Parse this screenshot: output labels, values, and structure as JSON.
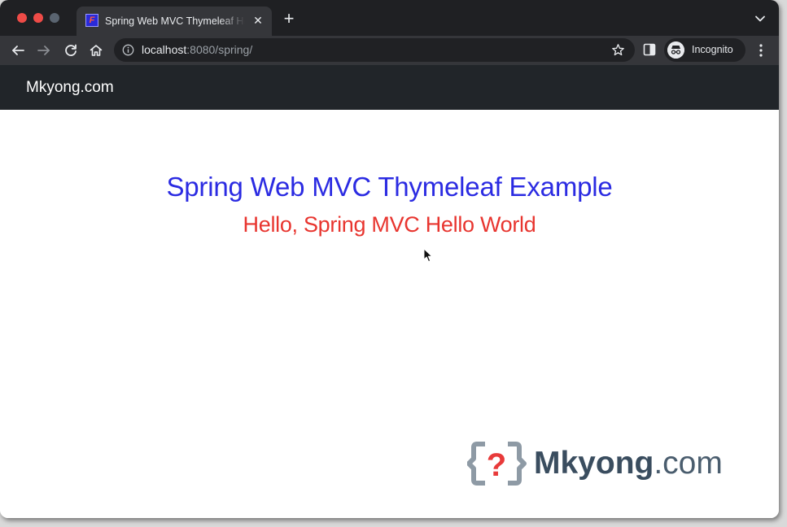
{
  "browser": {
    "tab": {
      "favicon_letter": "F",
      "title": "Spring Web MVC Thymeleaf Hello World",
      "close_glyph": "✕"
    },
    "new_tab_glyph": "+",
    "address": {
      "host": "localhost",
      "rest": ":8080/spring/"
    },
    "profile": {
      "label": "Incognito"
    },
    "icons": [
      "back-arrow-icon",
      "forward-arrow-icon",
      "reload-icon",
      "home-icon",
      "info-icon",
      "star-icon",
      "side-panel-icon",
      "incognito-icon",
      "kebab-menu-icon",
      "tab-search-icon"
    ]
  },
  "page": {
    "navbar": {
      "brand": "Mkyong.com"
    },
    "heading": "Spring Web MVC Thymeleaf Example",
    "message": "Hello, Spring MVC Hello World"
  },
  "watermark": {
    "logo_glyph": "?",
    "name_bold": "Mkyong",
    "name_suffix": ".com"
  },
  "colors": {
    "heading": "#2b2be2",
    "message": "#e8352f",
    "navbar": "#212529",
    "tabstrip": "#1f2023",
    "toolbar": "#35363a"
  }
}
